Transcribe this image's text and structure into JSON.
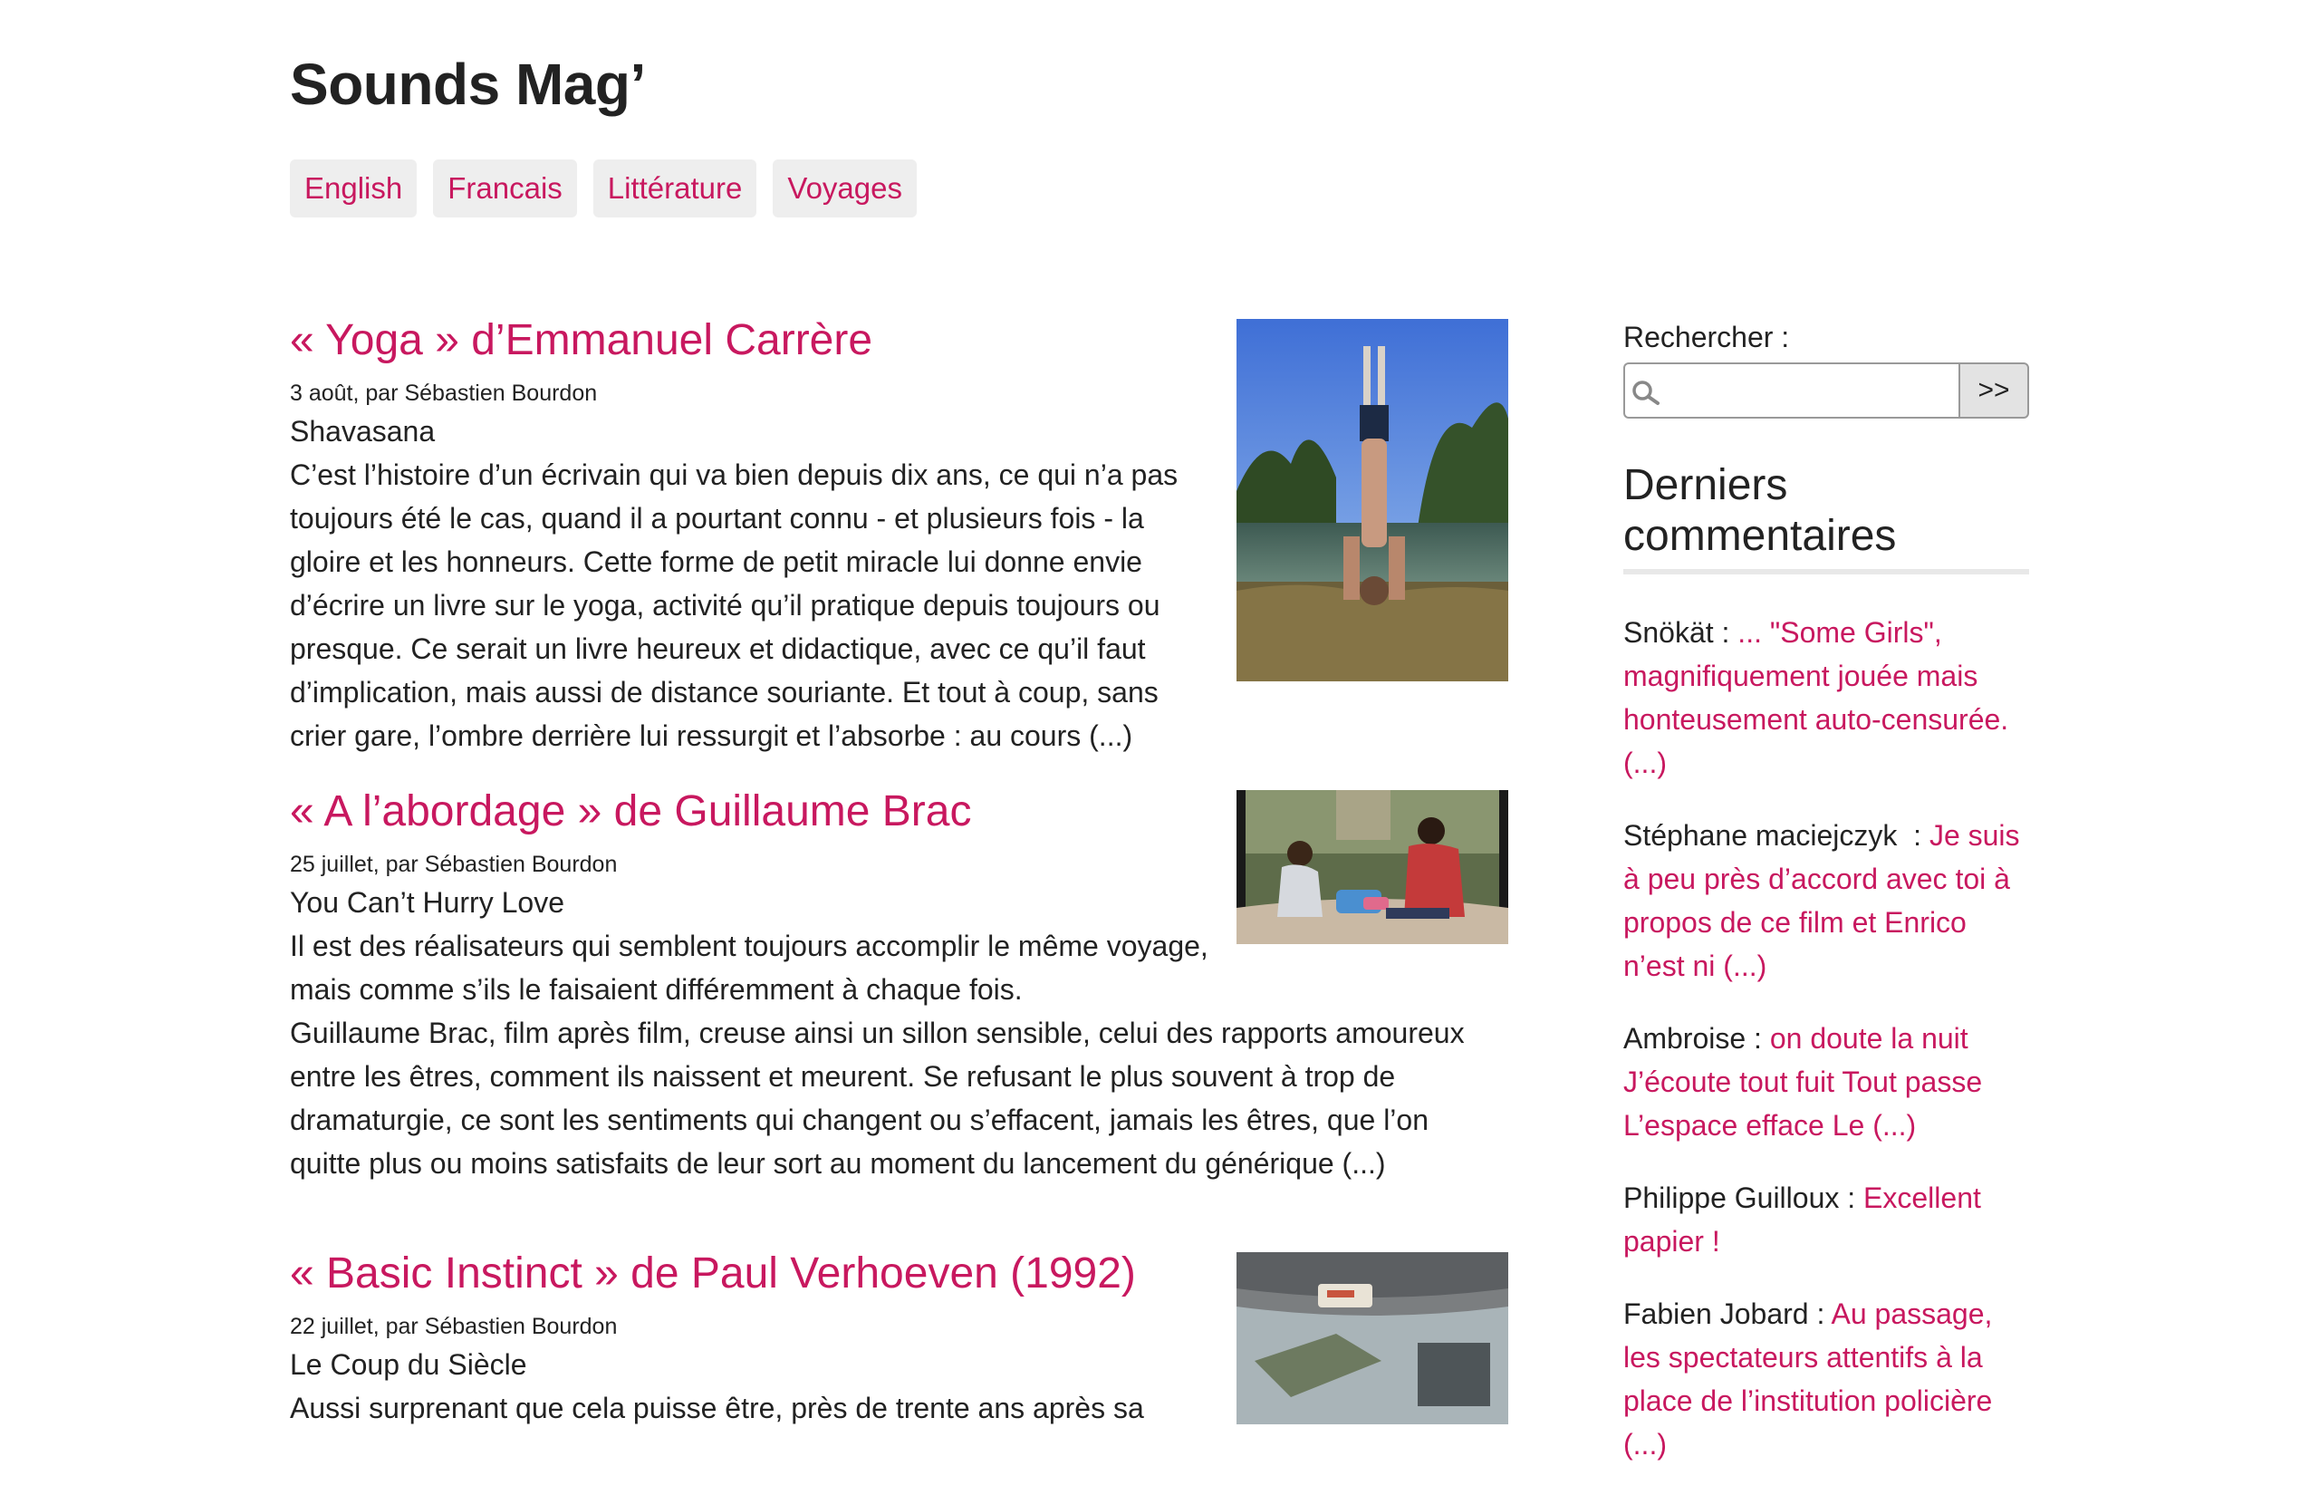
{
  "site": {
    "title": "Sounds Mag’"
  },
  "nav": [
    "English",
    "Francais",
    "Littérature",
    "Voyages"
  ],
  "articles": [
    {
      "title": "« Yoga » d’Emmanuel Carrère",
      "meta": "3 août, par Sébastien Bourdon",
      "subtitle": "Shavasana",
      "lines": [
        "C’est l’histoire d’un écrivain qui va bien depuis dix ans, ce qui n’a pas",
        "toujours été le cas, quand il a pourtant connu - et plusieurs fois - la",
        "gloire et les honneurs. Cette forme de petit miracle lui donne envie",
        "d’écrire un livre sur le yoga, activité qu’il pratique depuis toujours ou",
        "presque. Ce serait un livre heureux et didactique, avec ce qu’il faut",
        "d’implication, mais aussi de distance souriante. Et tout à coup, sans",
        "crier gare, l’ombre derrière lui ressurgit et l’absorbe : au cours (...)"
      ]
    },
    {
      "title": "« A l’abordage » de Guillaume Brac",
      "meta": "25 juillet, par Sébastien Bourdon",
      "subtitle": "You Can’t Hurry Love",
      "lines": [
        "Il est des réalisateurs qui semblent toujours accomplir le même voyage,",
        "mais comme s’ils le faisaient différemment à chaque fois.",
        "Guillaume Brac, film après film, creuse ainsi un sillon sensible, celui des rapports amoureux",
        "entre les êtres, comment ils naissent et meurent. Se refusant le plus souvent à trop de",
        "dramaturgie, ce sont les sentiments qui changent ou s’effacent, jamais les êtres, que l’on",
        "quitte plus ou moins satisfaits de leur sort au moment du lancement du générique (...)"
      ]
    },
    {
      "title": "« Basic Instinct » de Paul Verhoeven (1992)",
      "meta": "22 juillet, par Sébastien Bourdon",
      "subtitle": "Le Coup du Siècle",
      "lines": [
        "Aussi surprenant que cela puisse être, près de trente ans après sa"
      ]
    }
  ],
  "sidebar": {
    "search_label": "Rechercher :",
    "search_placeholder": "",
    "search_button": ">>",
    "comments_heading": "Derniers commentaires",
    "comments": [
      {
        "author": "Snökät : ",
        "text": "... \"Some Girls\", magnifiquement jouée mais honteusement auto-censurée. (...)"
      },
      {
        "author": "Stéphane maciejczyk  : ",
        "text": "Je suis à peu près d’accord avec toi à propos de ce film et Enrico n’est ni (...)"
      },
      {
        "author": "Ambroise : ",
        "text": "on doute la nuit J’écoute tout fuit Tout passe L’espace efface Le (...)"
      },
      {
        "author": "Philippe Guilloux : ",
        "text": "Excellent papier !"
      },
      {
        "author": "Fabien Jobard : ",
        "text": "Au passage, les spectateurs attentifs à la place de l’institution policière (...)"
      }
    ]
  }
}
